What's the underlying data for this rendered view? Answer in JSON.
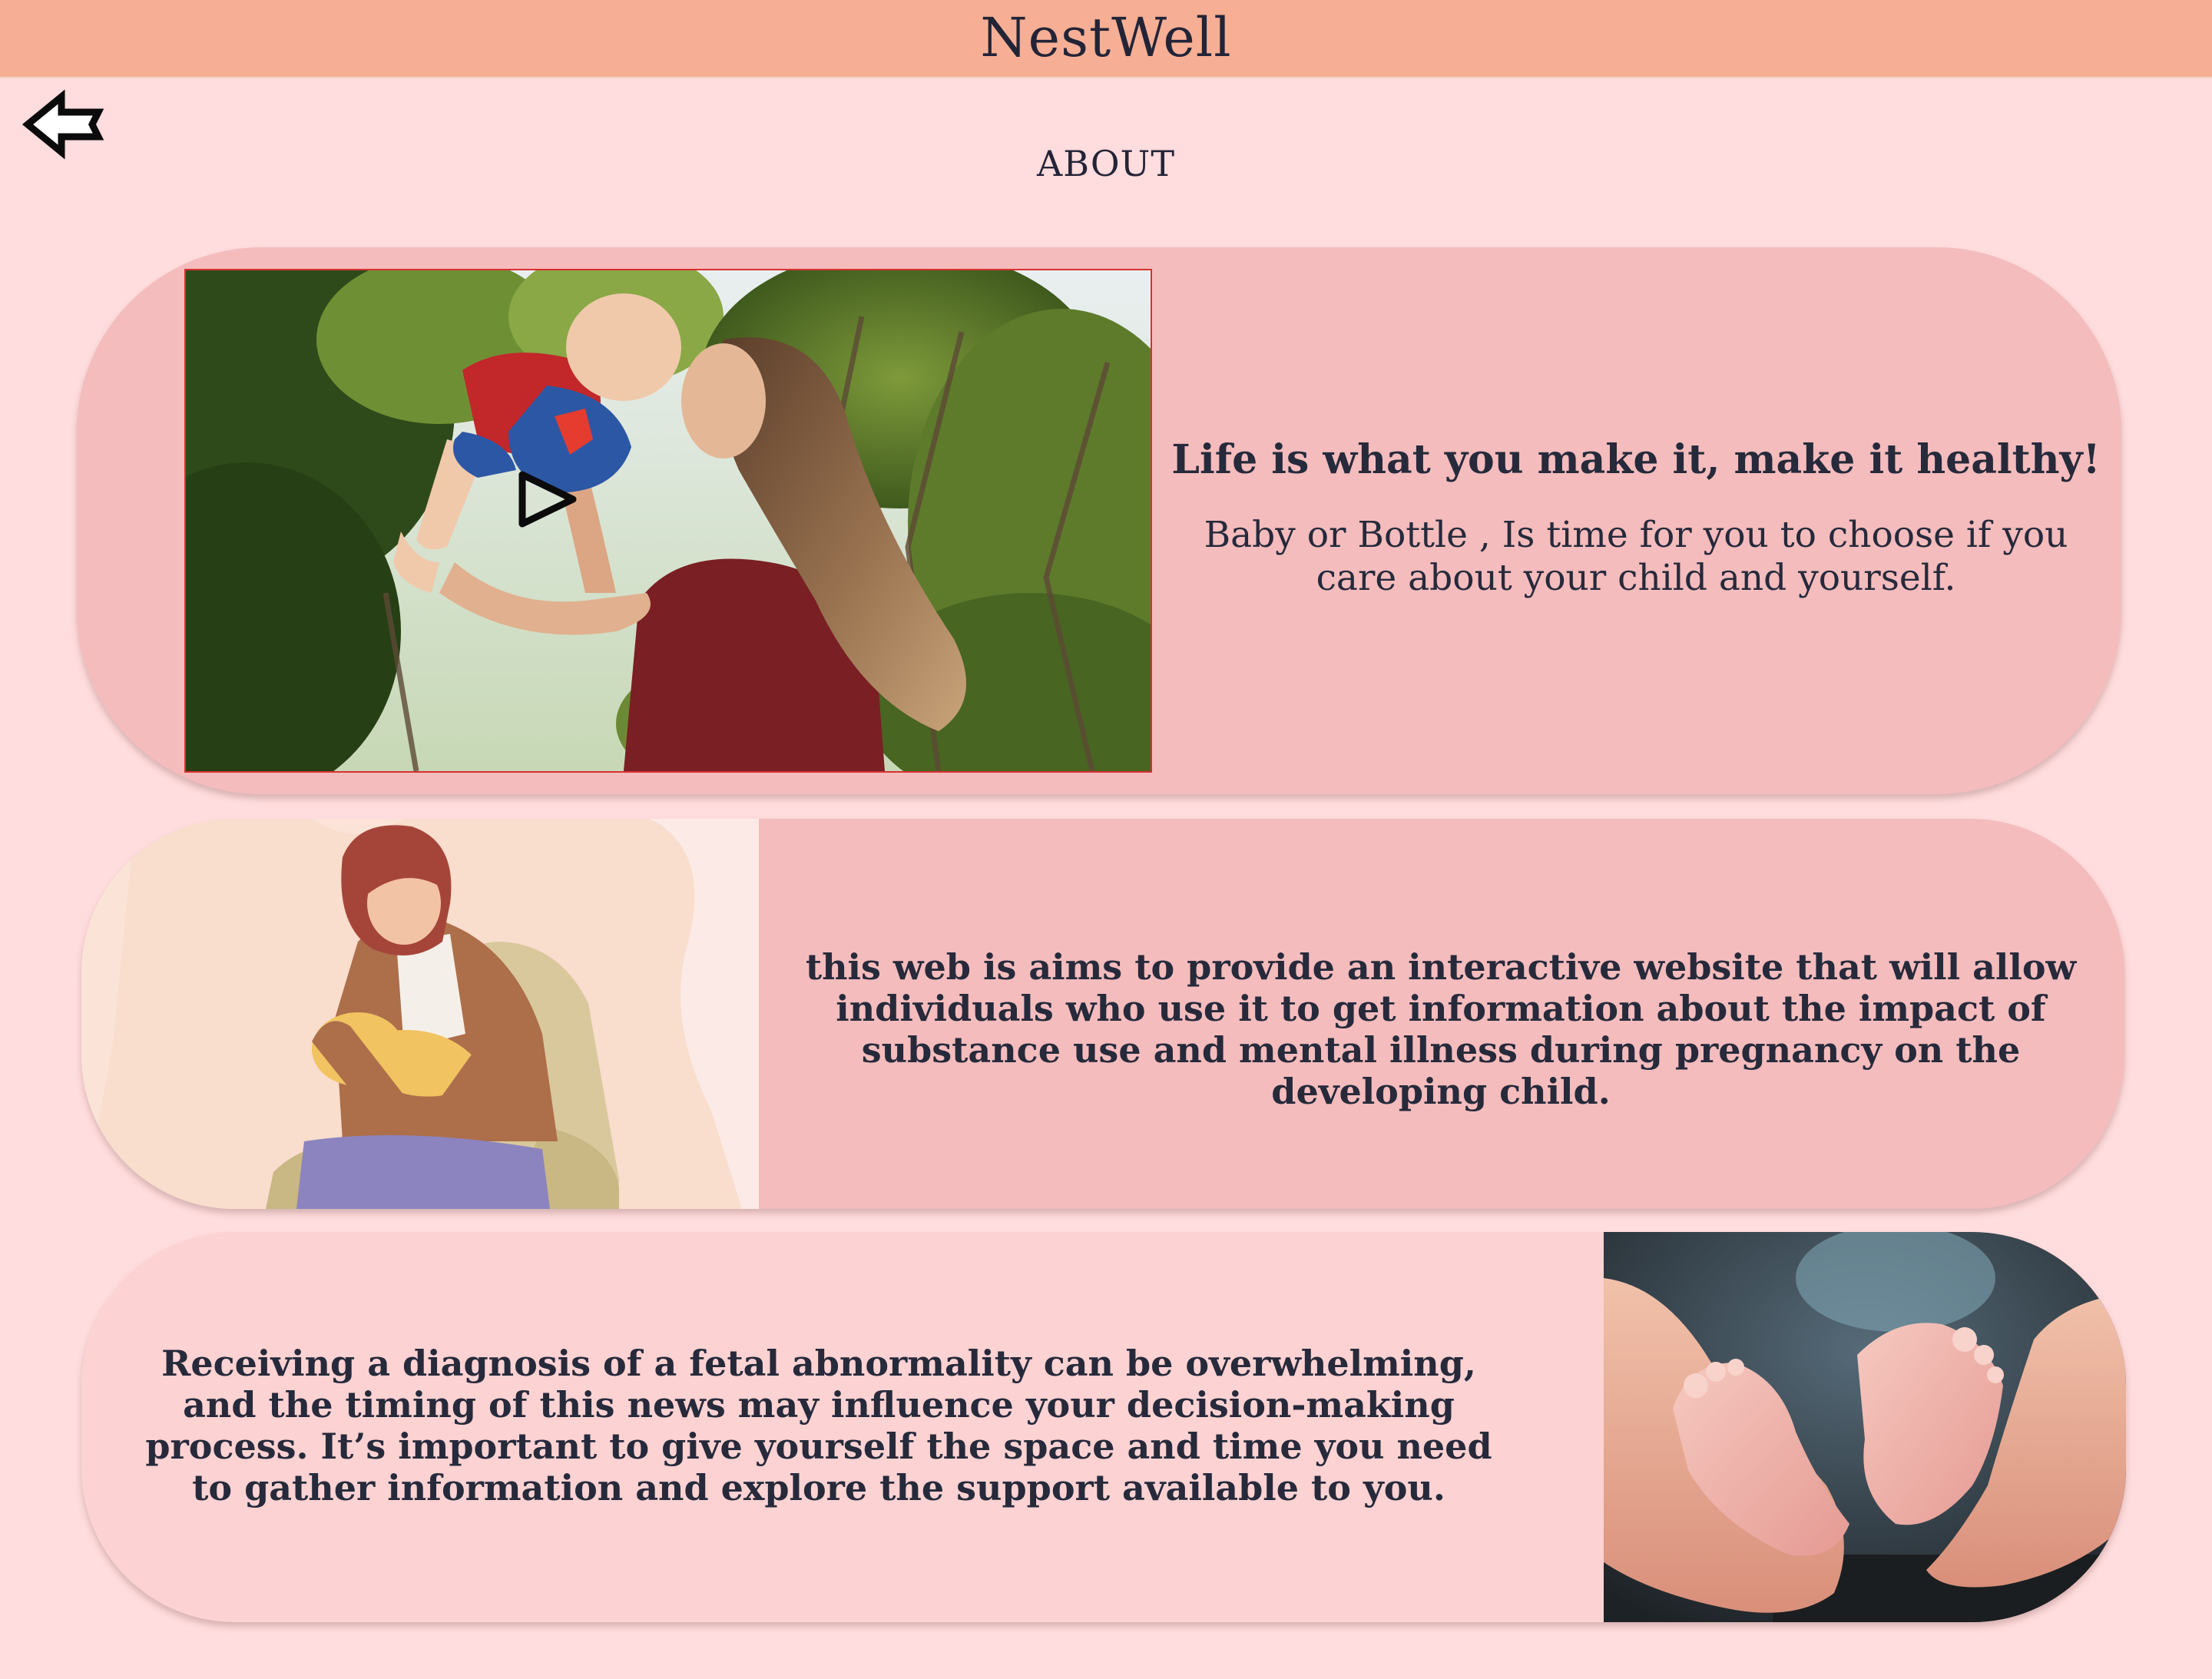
{
  "app": {
    "title": "NestWell"
  },
  "page": {
    "section_title": "ABOUT"
  },
  "nav": {
    "back_icon": "back-arrow-icon"
  },
  "cards": [
    {
      "image": "mother-lifting-baby-photo",
      "play_icon": "play-icon",
      "heading": "Life is what you make it, make it healthy!",
      "body": "Baby or Bottle , Is time for you to choose if you care about your child and yourself."
    },
    {
      "image": "mother-feeding-baby-illustration",
      "body": "this web is aims to provide an interactive website that will allow individuals who use it to get information about the impact of substance use and mental illness during pregnancy on the developing child."
    },
    {
      "image": "hands-holding-baby-feet-photo",
      "body": "Receiving a diagnosis of a fetal abnormality can be overwhelming, and the timing of this news may influence your decision-making process. It’s important to give yourself the space and time you need to gather information and explore the support available to you."
    }
  ],
  "colors": {
    "header_bg": "#f6af94",
    "page_bg": "#ffdcdd",
    "card_bg": "#f4bcbd",
    "card3_bg": "#fcd2d3",
    "text": "#262a3b"
  }
}
